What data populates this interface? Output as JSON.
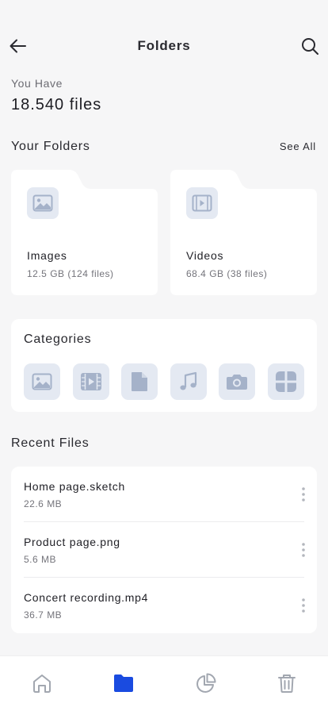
{
  "header": {
    "title": "Folders",
    "back_icon": "arrow-left-icon",
    "search_icon": "search-icon"
  },
  "summary": {
    "label": "You Have",
    "total": "18.540 files"
  },
  "folders_section": {
    "title": "Your Folders",
    "see_all": "See All",
    "folders": [
      {
        "name": "Images",
        "meta": "12.5 GB (124 files)",
        "icon": "image-icon"
      },
      {
        "name": "Videos",
        "meta": "68.4 GB (38 files)",
        "icon": "video-icon"
      }
    ]
  },
  "categories": {
    "title": "Categories",
    "items": [
      "image-icon",
      "video-icon",
      "document-icon",
      "music-icon",
      "camera-icon",
      "apps-icon"
    ]
  },
  "recent": {
    "title": "Recent Files",
    "files": [
      {
        "name": "Home page.sketch",
        "size": "22.6 MB"
      },
      {
        "name": "Product page.png",
        "size": "5.6 MB"
      },
      {
        "name": "Concert recording.mp4",
        "size": "36.7 MB"
      }
    ]
  },
  "tabbar": {
    "items": [
      "home-icon",
      "folder-icon",
      "pie-chart-icon",
      "trash-icon"
    ],
    "active": "folder-icon"
  },
  "colors": {
    "accent": "#1a4be0",
    "icon_tint": "#a5b2c9",
    "icon_bg": "#e4e9f2",
    "inactive": "#a2a7b0"
  }
}
